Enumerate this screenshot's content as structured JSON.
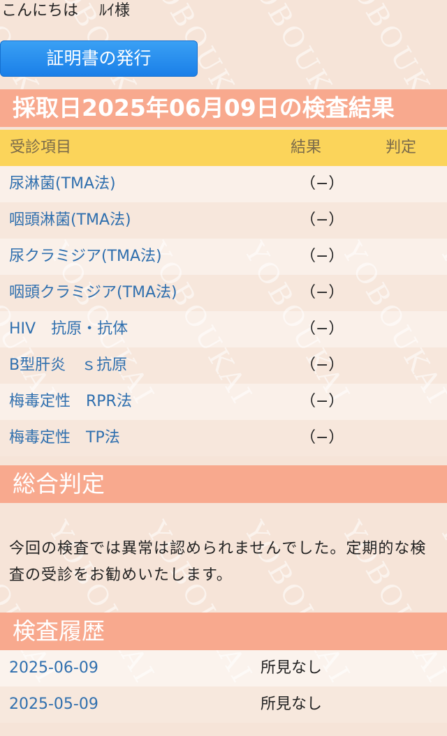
{
  "greeting": {
    "hello": "こんにちは",
    "name": "ﾙｲ様"
  },
  "certificate_button": "証明書の発行",
  "result_section": {
    "title": "採取日2025年06月09日の検査結果",
    "columns": [
      "受診項目",
      "結果",
      "判定"
    ],
    "rows": [
      {
        "item": "尿淋菌(TMA法)",
        "result": "（−）",
        "judgement": ""
      },
      {
        "item": "咽頭淋菌(TMA法)",
        "result": "（−）",
        "judgement": ""
      },
      {
        "item": "尿クラミジア(TMA法)",
        "result": "（−）",
        "judgement": ""
      },
      {
        "item": "咽頭クラミジア(TMA法)",
        "result": "（−）",
        "judgement": ""
      },
      {
        "item": "HIV　抗原・抗体",
        "result": "（−）",
        "judgement": ""
      },
      {
        "item": "B型肝炎　ｓ抗原",
        "result": "（−）",
        "judgement": ""
      },
      {
        "item": "梅毒定性　RPR法",
        "result": "（−）",
        "judgement": ""
      },
      {
        "item": "梅毒定性　TP法",
        "result": "（−）",
        "judgement": ""
      }
    ]
  },
  "overall_section": {
    "title": "総合判定",
    "text": "今回の検査では異常は認められませんでした。定期的な検査の受診をお勧めいたします。"
  },
  "history_section": {
    "title": "検査履歴",
    "rows": [
      {
        "date": "2025-06-09",
        "finding": "所見なし"
      },
      {
        "date": "2025-05-09",
        "finding": "所見なし"
      }
    ]
  },
  "watermark_text": "YOBOUKAI"
}
